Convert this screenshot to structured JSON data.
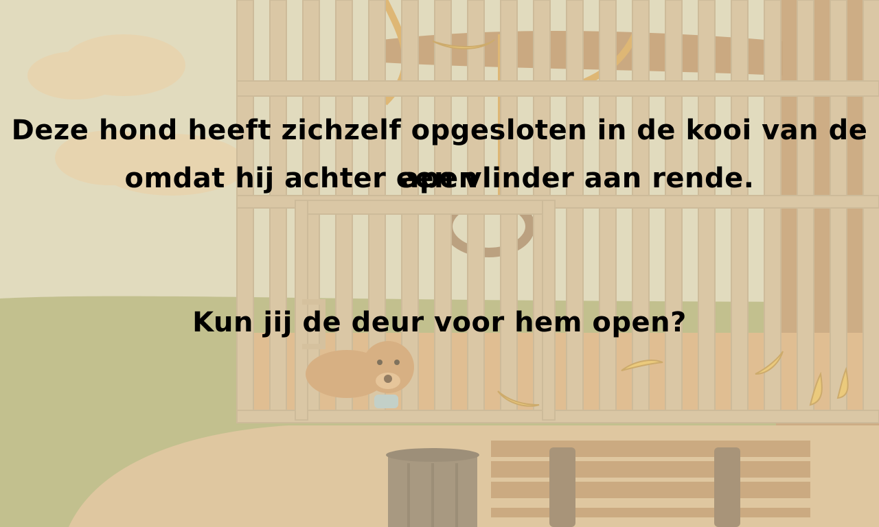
{
  "story": {
    "line1": "Deze hond heeft zichzelf opgesloten in de kooi van de apen",
    "line2": "omdat hij achter een vlinder aan rende.",
    "question": "Kun jij de deur voor hem open?"
  },
  "colors": {
    "sky": "#d9d3b4",
    "grass": "#a7a867",
    "path": "#d6b484",
    "cage_bar": "#cdb48c",
    "cage_floor": "#d7a56c",
    "tree": "#b98a57",
    "banana": "#e8b94a",
    "overlay": "#efe7cf"
  },
  "scene": {
    "cage_has_door": true,
    "dog_inside_cage": true
  }
}
